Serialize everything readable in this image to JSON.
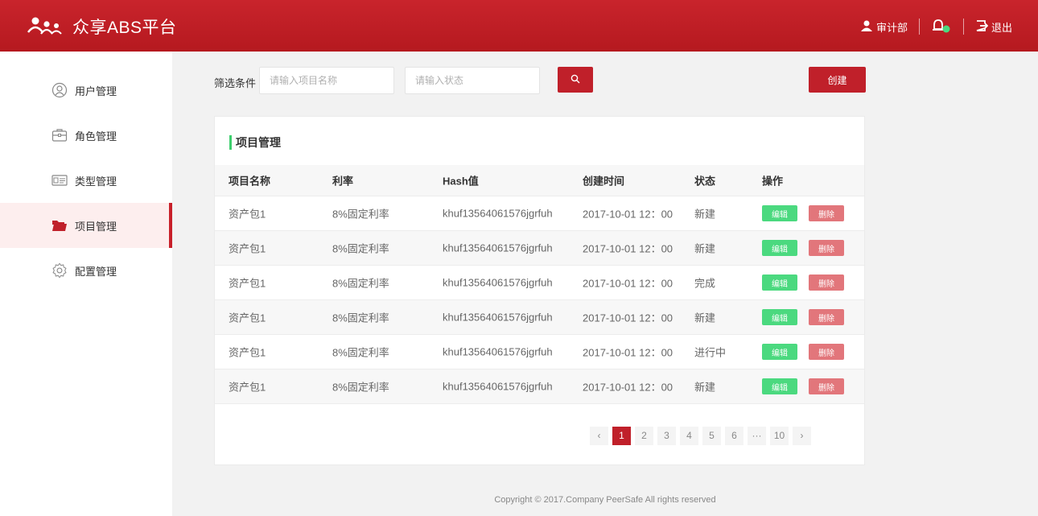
{
  "header": {
    "title": "众享ABS平台",
    "user": "审计部",
    "logout": "退出",
    "accent": "#c0202a"
  },
  "sidebar": {
    "items": [
      {
        "label": "用户管理",
        "icon": "user-icon"
      },
      {
        "label": "角色管理",
        "icon": "briefcase-icon"
      },
      {
        "label": "类型管理",
        "icon": "id-card-icon"
      },
      {
        "label": "项目管理",
        "icon": "folder-icon",
        "active": true
      },
      {
        "label": "配置管理",
        "icon": "gear-icon"
      }
    ]
  },
  "filter": {
    "label": "筛选条件",
    "name_placeholder": "请输入项目名称",
    "status_placeholder": "请输入状态",
    "create_label": "创建"
  },
  "table": {
    "title": "项目管理",
    "headers": [
      "项目名称",
      "利率",
      "Hash值",
      "创建时间",
      "状态",
      "操作"
    ],
    "edit_label": "编辑",
    "delete_label": "删除",
    "rows": [
      {
        "name": "资产包1",
        "rate": "8%固定利率",
        "hash": "khuf13564061576jgrfuh",
        "time": "2017-10-01 12：00",
        "status": "新建"
      },
      {
        "name": "资产包1",
        "rate": "8%固定利率",
        "hash": "khuf13564061576jgrfuh",
        "time": "2017-10-01 12：00",
        "status": "新建"
      },
      {
        "name": "资产包1",
        "rate": "8%固定利率",
        "hash": "khuf13564061576jgrfuh",
        "time": "2017-10-01 12：00",
        "status": "完成"
      },
      {
        "name": "资产包1",
        "rate": "8%固定利率",
        "hash": "khuf13564061576jgrfuh",
        "time": "2017-10-01 12：00",
        "status": "新建"
      },
      {
        "name": "资产包1",
        "rate": "8%固定利率",
        "hash": "khuf13564061576jgrfuh",
        "time": "2017-10-01 12：00",
        "status": "进行中"
      },
      {
        "name": "资产包1",
        "rate": "8%固定利率",
        "hash": "khuf13564061576jgrfuh",
        "time": "2017-10-01 12：00",
        "status": "新建"
      }
    ]
  },
  "pagination": {
    "prev": "‹",
    "pages": [
      "1",
      "2",
      "3",
      "4",
      "5",
      "6",
      "···",
      "10"
    ],
    "current": "1",
    "next": "›"
  },
  "footer": {
    "text": "Copyright © 2017.Company PeerSafe All rights reserved"
  }
}
